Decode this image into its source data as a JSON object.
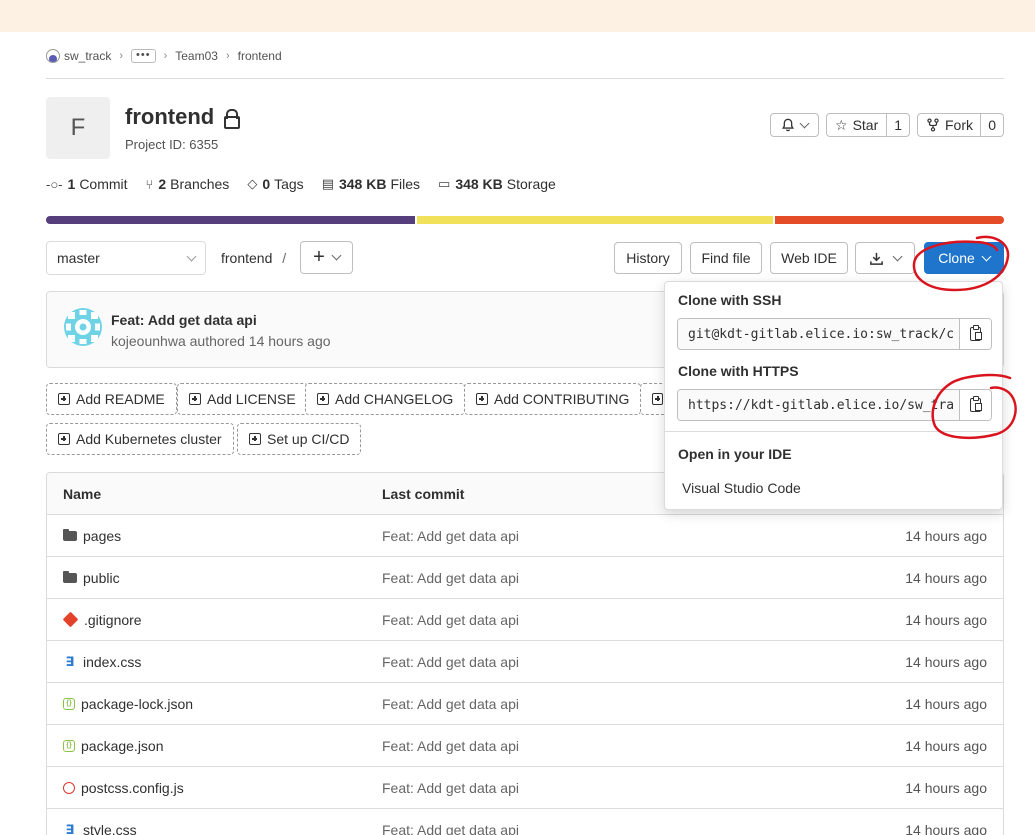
{
  "breadcrumb": {
    "items": [
      "sw_track",
      "Team03",
      "frontend"
    ],
    "more": "•••"
  },
  "project": {
    "avatar_letter": "F",
    "name": "frontend",
    "id_label": "Project ID: 6355"
  },
  "actions": {
    "star_label": "Star",
    "star_count": "1",
    "fork_label": "Fork",
    "fork_count": "0"
  },
  "stats": [
    {
      "icon": "commit-icon",
      "num": "1",
      "label": "Commit"
    },
    {
      "icon": "branch-icon",
      "num": "2",
      "label": "Branches"
    },
    {
      "icon": "tag-icon",
      "num": "0",
      "label": "Tags"
    },
    {
      "icon": "file-icon",
      "num": "348 KB",
      "label": "Files"
    },
    {
      "icon": "storage-icon",
      "num": "348 KB",
      "label": "Storage"
    }
  ],
  "language_bar": [
    {
      "color": "#563d7c",
      "share": 0.387
    },
    {
      "color": "#f1e05a",
      "share": 0.373
    },
    {
      "color": "#e34c26",
      "share": 0.24
    }
  ],
  "toolbar": {
    "branch": "master",
    "path": "frontend",
    "path_sep": "/",
    "history": "History",
    "find_file": "Find file",
    "web_ide": "Web IDE",
    "clone": "Clone"
  },
  "commit": {
    "title": "Feat: Add get data api",
    "author": "kojeounhwa",
    "action": "authored",
    "time": "14 hours ago"
  },
  "quick_actions": [
    "Add README",
    "Add LICENSE",
    "Add CHANGELOG",
    "Add CONTRIBUTING",
    "Add Kubernetes cluster",
    "Set up CI/CD"
  ],
  "table": {
    "headers": {
      "name": "Name",
      "last_commit": "Last commit"
    },
    "rows": [
      {
        "name": "pages",
        "icon": "folder",
        "commit": "Feat: Add get data api",
        "time": "14 hours ago"
      },
      {
        "name": "public",
        "icon": "folder",
        "commit": "Feat: Add get data api",
        "time": "14 hours ago"
      },
      {
        "name": ".gitignore",
        "icon": "git",
        "commit": "Feat: Add get data api",
        "time": "14 hours ago"
      },
      {
        "name": "index.css",
        "icon": "css",
        "commit": "Feat: Add get data api",
        "time": "14 hours ago"
      },
      {
        "name": "package-lock.json",
        "icon": "json",
        "commit": "Feat: Add get data api",
        "time": "14 hours ago"
      },
      {
        "name": "package.json",
        "icon": "json",
        "commit": "Feat: Add get data api",
        "time": "14 hours ago"
      },
      {
        "name": "postcss.config.js",
        "icon": "postcss",
        "commit": "Feat: Add get data api",
        "time": "14 hours ago"
      },
      {
        "name": "style.css",
        "icon": "css",
        "commit": "Feat: Add get data api",
        "time": "14 hours ago"
      }
    ]
  },
  "clone_dropdown": {
    "ssh_label": "Clone with SSH",
    "ssh_url": "git@kdt-gitlab.elice.io:sw_track/c",
    "https_label": "Clone with HTTPS",
    "https_url": "https://kdt-gitlab.elice.io/sw_tra",
    "ide_label": "Open in your IDE",
    "ide_option": "Visual Studio Code"
  },
  "colors": {
    "accent": "#1f75cb",
    "annotation": "#d9141e",
    "lang_bar": [
      "#563d7c",
      "#f1e05a",
      "#e34c26"
    ]
  }
}
